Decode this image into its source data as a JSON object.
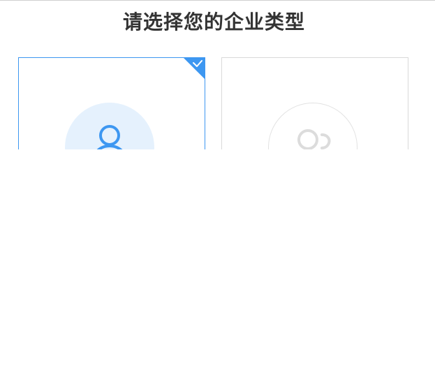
{
  "page": {
    "title": "请选择您的企业类型"
  },
  "options": [
    {
      "icon": "user-icon",
      "selected": true,
      "accent_color": "#3d97f1",
      "circle_color": "#e5f1fd"
    },
    {
      "icon": "users-icon",
      "selected": false,
      "accent_color": "#dcdcdc"
    }
  ]
}
